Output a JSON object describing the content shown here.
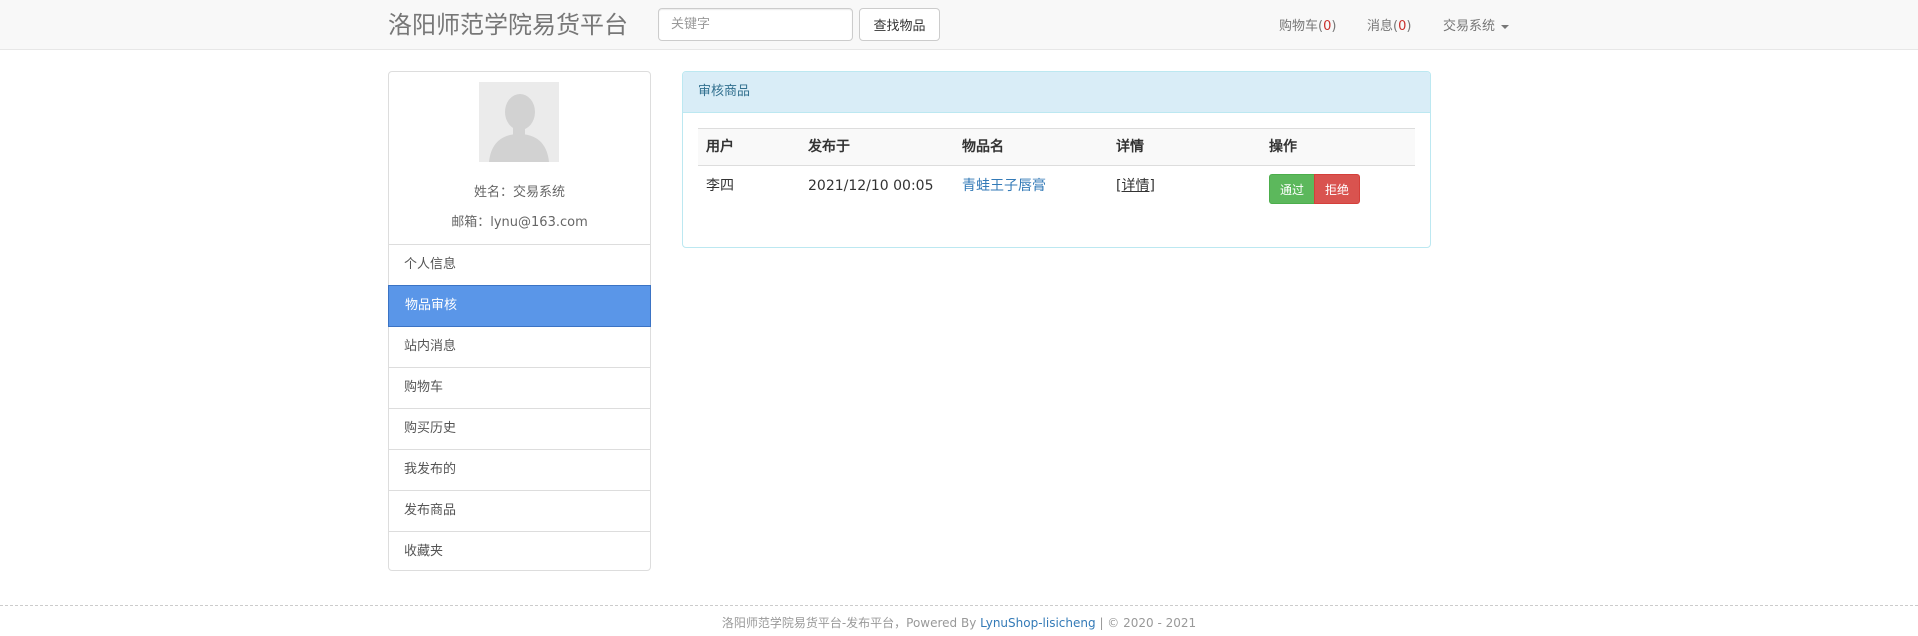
{
  "navbar": {
    "brand": "洛阳师范学院易货平台",
    "search_placeholder": "关键字",
    "search_button": "查找物品",
    "cart_label": "购物车(",
    "cart_count": "0",
    "cart_close": ")",
    "msg_label": "消息(",
    "msg_count": "0",
    "msg_close": ")",
    "user_menu": "交易系统"
  },
  "sidebar": {
    "name_line": "姓名：交易系统",
    "email_line": "邮箱：lynu@163.com",
    "items": [
      {
        "label": "个人信息"
      },
      {
        "label": "物品审核"
      },
      {
        "label": "站内消息"
      },
      {
        "label": "购物车"
      },
      {
        "label": "购买历史"
      },
      {
        "label": "我发布的"
      },
      {
        "label": "发布商品"
      },
      {
        "label": "收藏夹"
      }
    ],
    "active_index": 1
  },
  "panel": {
    "title": "审核商品",
    "columns": [
      "用户",
      "发布于",
      "物品名",
      "详情",
      "操作"
    ],
    "rows": [
      {
        "user": "李四",
        "published": "2021/12/10 00:05",
        "item": "青蛙王子唇膏",
        "detail": "[详情]",
        "approve": "通过",
        "reject": "拒绝"
      }
    ]
  },
  "footer": {
    "text": "洛阳师范学院易货平台-发布平台，Powered By ",
    "link": "LynuShop-lisicheng",
    "suffix": " | © 2020 - 2021"
  }
}
